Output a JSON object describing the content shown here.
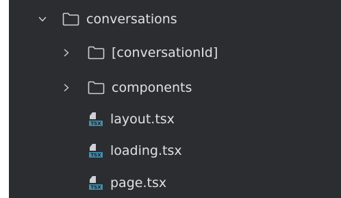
{
  "tree": {
    "items": [
      {
        "label": "conversations",
        "kind": "folder",
        "expanded": true,
        "depth": 0,
        "icon": "folder-icon",
        "toggle_icon": "chevron-down-icon"
      },
      {
        "label": "[conversationId]",
        "kind": "folder",
        "expanded": false,
        "depth": 1,
        "icon": "folder-icon",
        "toggle_icon": "chevron-right-icon"
      },
      {
        "label": "components",
        "kind": "folder",
        "expanded": false,
        "depth": 1,
        "icon": "folder-icon",
        "toggle_icon": "chevron-right-icon"
      },
      {
        "label": "layout.tsx",
        "kind": "file",
        "depth": 1,
        "icon": "tsx-file-icon"
      },
      {
        "label": "loading.tsx",
        "kind": "file",
        "depth": 1,
        "icon": "tsx-file-icon"
      },
      {
        "label": "page.tsx",
        "kind": "file",
        "depth": 1,
        "icon": "tsx-file-icon"
      }
    ]
  },
  "colors": {
    "panel_background": "#2b2d30",
    "text": "#dfe1e5",
    "icon_gray": "#ced0d6",
    "tsx_blue": "#3f8fb0"
  }
}
